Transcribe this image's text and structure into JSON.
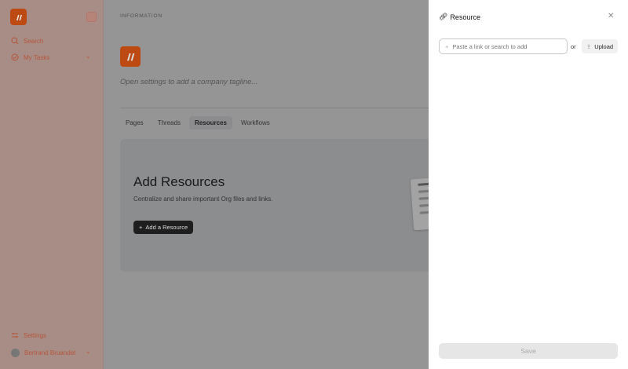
{
  "sidebar": {
    "items": [
      {
        "label": "Search"
      },
      {
        "label": "My Tasks"
      }
    ],
    "settings": "Settings",
    "user": "Bertrand Bruandet"
  },
  "main": {
    "section": "INFORMATION",
    "tagline": "Open settings to add a company tagline...",
    "tabs": [
      {
        "label": "Pages"
      },
      {
        "label": "Threads"
      },
      {
        "label": "Resources"
      },
      {
        "label": "Workflows"
      }
    ],
    "empty": {
      "title": "Add Resources",
      "description": "Centralize and share important Org files and links.",
      "button": "Add a Resource"
    }
  },
  "panel": {
    "title": "Resource",
    "placeholder": "Paste a link or search to add",
    "or": "or",
    "upload": "Upload",
    "save": "Save"
  },
  "colors": {
    "brand": "#bc4a12"
  }
}
